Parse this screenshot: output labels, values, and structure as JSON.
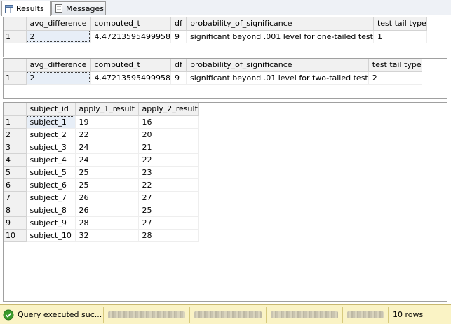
{
  "tabs": {
    "results_label": "Results",
    "messages_label": "Messages"
  },
  "grid1": {
    "headers": [
      "avg_difference",
      "computed_t",
      "df",
      "probability_of_significance",
      "test tail type"
    ],
    "rows": [
      {
        "num": "1",
        "cells": [
          "2",
          "4.47213595499958",
          "9",
          "significant beyond .001 level for one-tailed test",
          "1"
        ]
      }
    ]
  },
  "grid2": {
    "headers": [
      "avg_difference",
      "computed_t",
      "df",
      "probability_of_significance",
      "test tail type"
    ],
    "rows": [
      {
        "num": "1",
        "cells": [
          "2",
          "4.47213595499958",
          "9",
          "significant beyond .01 level for two-tailed test",
          "2"
        ]
      }
    ]
  },
  "grid3": {
    "headers": [
      "subject_id",
      "apply_1_result",
      "apply_2_result"
    ],
    "rows": [
      {
        "num": "1",
        "cells": [
          "subject_1",
          "19",
          "16"
        ]
      },
      {
        "num": "2",
        "cells": [
          "subject_2",
          "22",
          "20"
        ]
      },
      {
        "num": "3",
        "cells": [
          "subject_3",
          "24",
          "21"
        ]
      },
      {
        "num": "4",
        "cells": [
          "subject_4",
          "24",
          "22"
        ]
      },
      {
        "num": "5",
        "cells": [
          "subject_5",
          "25",
          "23"
        ]
      },
      {
        "num": "6",
        "cells": [
          "subject_6",
          "25",
          "22"
        ]
      },
      {
        "num": "7",
        "cells": [
          "subject_7",
          "26",
          "27"
        ]
      },
      {
        "num": "8",
        "cells": [
          "subject_8",
          "26",
          "25"
        ]
      },
      {
        "num": "9",
        "cells": [
          "subject_9",
          "28",
          "27"
        ]
      },
      {
        "num": "10",
        "cells": [
          "subject_10",
          "32",
          "28"
        ]
      }
    ]
  },
  "status": {
    "message": "Query executed suc...",
    "row_count": "10 rows",
    "icon": "check-circle-icon",
    "success_color": "#3a9a2a",
    "bar_color": "#faf3c5"
  }
}
